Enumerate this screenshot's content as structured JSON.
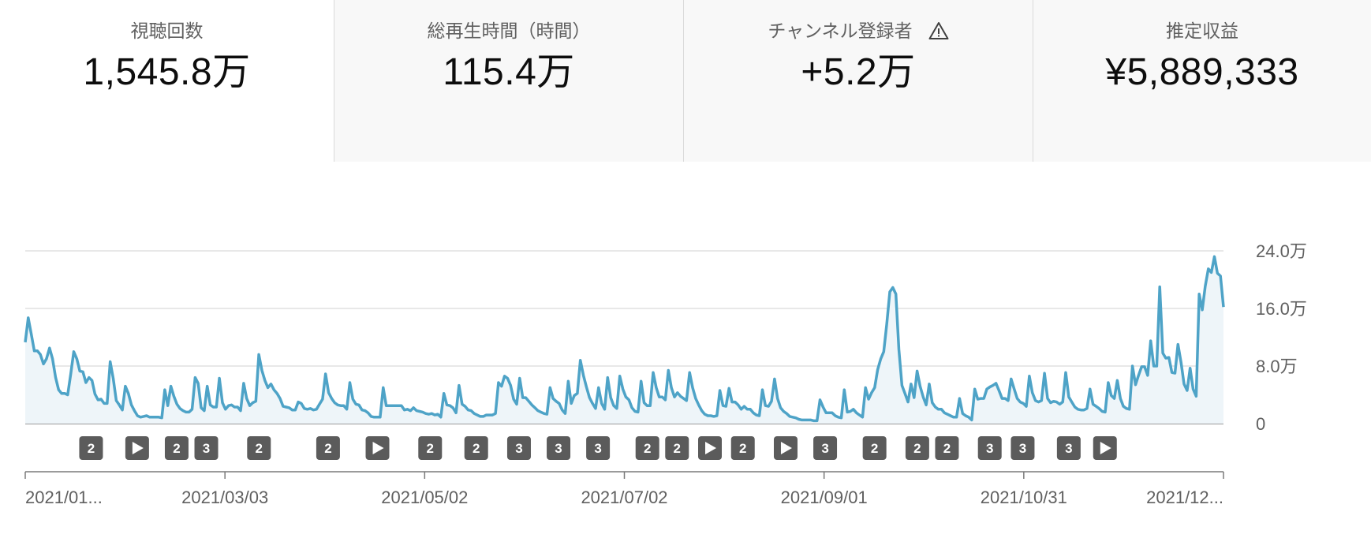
{
  "metrics": [
    {
      "label": "視聴回数",
      "value": "1,545.8万",
      "selected": true
    },
    {
      "label": "総再生時間（時間）",
      "value": "115.4万",
      "selected": false
    },
    {
      "label": "チャンネル登録者",
      "value": "+5.2万",
      "selected": false,
      "warning_icon": "warning-icon"
    },
    {
      "label": "推定収益",
      "value": "¥5,889,333",
      "selected": false
    }
  ],
  "colors": {
    "line": "#4ea3c7",
    "area": "#eef5f9",
    "grid": "#e0e0e0",
    "marker": "#5b5b5b"
  },
  "chart_data": {
    "type": "area",
    "title": "",
    "xlabel": "",
    "ylabel": "",
    "ylim": [
      0,
      240000
    ],
    "y_ticks": [
      {
        "value": 240000,
        "label": "24.0万"
      },
      {
        "value": 160000,
        "label": "16.0万"
      },
      {
        "value": 80000,
        "label": "8.0万"
      },
      {
        "value": 0,
        "label": "0"
      }
    ],
    "x_range": [
      "2021-01-01",
      "2021-12-31"
    ],
    "x_ticks": [
      "2021/01...",
      "2021/03/03",
      "2021/05/02",
      "2021/07/02",
      "2021/09/01",
      "2021/10/31",
      "2021/12..."
    ],
    "grid": true,
    "series": [
      {
        "values": [
          113000,
          147000,
          124000,
          101000,
          101000,
          96000,
          83000,
          90000,
          105000,
          90000,
          64000,
          47000,
          42000,
          42000,
          40000,
          69000,
          100000,
          90000,
          73000,
          72000,
          57000,
          64000,
          60000,
          41000,
          33000,
          34000,
          28000,
          28000,
          86000,
          63000,
          32000,
          26000,
          19000,
          52000,
          42000,
          26000,
          18000,
          11000,
          9000,
          10000,
          11000,
          9000,
          9000,
          9000,
          9000,
          8000,
          47000,
          25000,
          52000,
          38000,
          27000,
          21000,
          18000,
          16000,
          16000,
          20000,
          64000,
          56000,
          22000,
          18000,
          52000,
          26000,
          23000,
          23000,
          63000,
          29000,
          20000,
          25000,
          26000,
          23000,
          23000,
          18000,
          56000,
          35000,
          25000,
          29000,
          31000,
          96000,
          74000,
          60000,
          50000,
          55000,
          47000,
          42000,
          35000,
          24000,
          23000,
          22000,
          19000,
          19000,
          30000,
          28000,
          21000,
          20000,
          21000,
          19000,
          20000,
          27000,
          34000,
          69000,
          43000,
          35000,
          29000,
          26000,
          25000,
          25000,
          20000,
          57000,
          34000,
          27000,
          26000,
          19000,
          18000,
          15000,
          10000,
          9000,
          9000,
          9000,
          50000,
          25000,
          25000,
          25000,
          25000,
          25000,
          25000,
          19000,
          20000,
          18000,
          22000,
          18000,
          17000,
          16000,
          14000,
          13000,
          14000,
          12000,
          13000,
          9000,
          42000,
          26000,
          25000,
          22000,
          15000,
          53000,
          27000,
          24000,
          19000,
          18000,
          14000,
          12000,
          10000,
          10000,
          12000,
          12000,
          12000,
          14000,
          57000,
          52000,
          66000,
          63000,
          53000,
          34000,
          27000,
          63000,
          36000,
          36000,
          31000,
          26000,
          22000,
          18000,
          16000,
          14000,
          13000,
          50000,
          35000,
          31000,
          28000,
          19000,
          14000,
          59000,
          28000,
          39000,
          42000,
          88000,
          67000,
          51000,
          36000,
          28000,
          21000,
          50000,
          28000,
          20000,
          64000,
          36000,
          25000,
          21000,
          66000,
          48000,
          37000,
          33000,
          22000,
          17000,
          16000,
          59000,
          29000,
          25000,
          25000,
          71000,
          50000,
          37000,
          37000,
          33000,
          74000,
          50000,
          37000,
          43000,
          38000,
          35000,
          32000,
          71000,
          50000,
          35000,
          26000,
          18000,
          13000,
          11000,
          11000,
          10000,
          11000,
          46000,
          25000,
          24000,
          49000,
          30000,
          30000,
          26000,
          20000,
          24000,
          20000,
          20000,
          15000,
          12000,
          11000,
          47000,
          25000,
          24000,
          31000,
          62000,
          35000,
          22000,
          17000,
          14000,
          10000,
          9000,
          8000,
          6000,
          5000,
          5000,
          5000,
          5000,
          4000,
          4000,
          33000,
          23000,
          15000,
          15000,
          15000,
          11000,
          9000,
          8000,
          47000,
          16000,
          17000,
          20000,
          15000,
          12000,
          9000,
          50000,
          34000,
          43000,
          50000,
          75000,
          90000,
          100000,
          138000,
          183000,
          189000,
          180000,
          103000,
          53000,
          42000,
          30000,
          55000,
          36000,
          73000,
          52000,
          37000,
          26000,
          55000,
          29000,
          23000,
          20000,
          20000,
          15000,
          13000,
          11000,
          9000,
          9000,
          35000,
          14000,
          11000,
          9000,
          5000,
          48000,
          34000,
          35000,
          35000,
          48000,
          51000,
          53000,
          56000,
          46000,
          35000,
          35000,
          32000,
          62000,
          48000,
          35000,
          30000,
          28000,
          24000,
          66000,
          43000,
          32000,
          30000,
          32000,
          70000,
          35000,
          29000,
          31000,
          30000,
          27000,
          30000,
          71000,
          37000,
          30000,
          23000,
          20000,
          19000,
          19000,
          21000,
          48000,
          27000,
          24000,
          21000,
          17000,
          16000,
          57000,
          39000,
          35000,
          60000,
          35000,
          24000,
          21000,
          20000,
          80000,
          54000,
          67000,
          79000,
          79000,
          67000,
          115000,
          80000,
          80000,
          190000,
          98000,
          91000,
          92000,
          71000,
          70000,
          110000,
          85000,
          55000,
          46000,
          77000,
          48000,
          38000,
          180000,
          158000,
          191000,
          215000,
          210000,
          232000,
          209000,
          205000,
          162000
        ]
      }
    ],
    "event_markers": [
      {
        "date": "2021-01-21",
        "kind": "count",
        "label": "2"
      },
      {
        "date": "2021-02-04",
        "kind": "video",
        "label": ""
      },
      {
        "date": "2021-02-16",
        "kind": "count",
        "label": "2"
      },
      {
        "date": "2021-02-25",
        "kind": "count",
        "label": "3"
      },
      {
        "date": "2021-03-13",
        "kind": "count",
        "label": "2"
      },
      {
        "date": "2021-04-03",
        "kind": "count",
        "label": "2"
      },
      {
        "date": "2021-04-18",
        "kind": "video",
        "label": ""
      },
      {
        "date": "2021-05-04",
        "kind": "count",
        "label": "2"
      },
      {
        "date": "2021-05-18",
        "kind": "count",
        "label": "2"
      },
      {
        "date": "2021-05-31",
        "kind": "count",
        "label": "3"
      },
      {
        "date": "2021-06-12",
        "kind": "count",
        "label": "3"
      },
      {
        "date": "2021-06-24",
        "kind": "count",
        "label": "3"
      },
      {
        "date": "2021-07-09",
        "kind": "count",
        "label": "2"
      },
      {
        "date": "2021-07-18",
        "kind": "count",
        "label": "2"
      },
      {
        "date": "2021-07-28",
        "kind": "video",
        "label": ""
      },
      {
        "date": "2021-08-07",
        "kind": "count",
        "label": "2"
      },
      {
        "date": "2021-08-20",
        "kind": "video",
        "label": ""
      },
      {
        "date": "2021-09-01",
        "kind": "count",
        "label": "3"
      },
      {
        "date": "2021-09-16",
        "kind": "count",
        "label": "2"
      },
      {
        "date": "2021-09-29",
        "kind": "count",
        "label": "2"
      },
      {
        "date": "2021-10-08",
        "kind": "count",
        "label": "2"
      },
      {
        "date": "2021-10-21",
        "kind": "count",
        "label": "3"
      },
      {
        "date": "2021-10-31",
        "kind": "count",
        "label": "3"
      },
      {
        "date": "2021-11-14",
        "kind": "count",
        "label": "3"
      },
      {
        "date": "2021-11-25",
        "kind": "video",
        "label": ""
      }
    ]
  }
}
